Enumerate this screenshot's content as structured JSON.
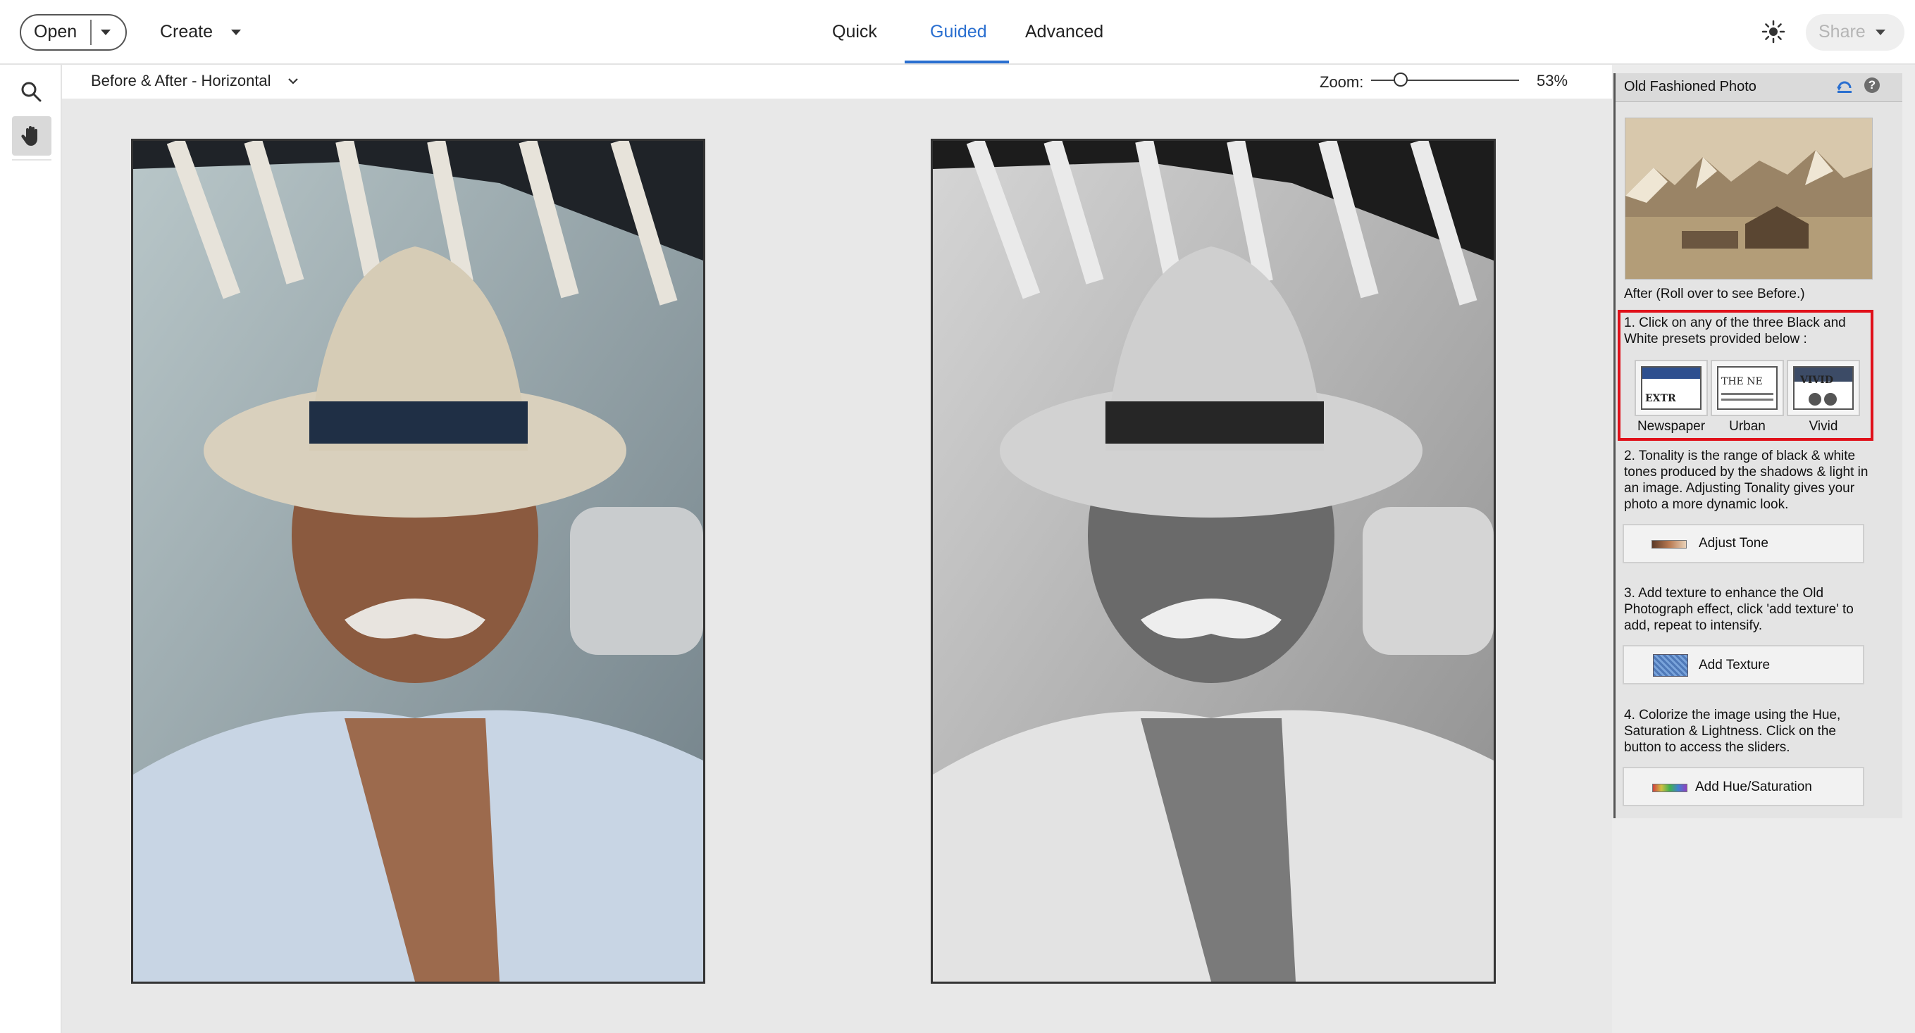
{
  "topbar": {
    "open_label": "Open",
    "create_label": "Create",
    "tabs": [
      {
        "label": "Quick"
      },
      {
        "label": "Guided"
      },
      {
        "label": "Advanced"
      }
    ],
    "active_tab": "Guided",
    "share_label": "Share"
  },
  "viewbar": {
    "view_mode": "Before & After - Horizontal",
    "zoom_label": "Zoom:",
    "zoom_value": "53%"
  },
  "panel": {
    "title": "Old Fashioned Photo",
    "help_glyph": "?",
    "preview_caption": "After (Roll over to see Before.)",
    "step1": "1. Click on any of the three Black and White presets provided below :",
    "presets": [
      {
        "label": "Newspaper",
        "thumb_text": "EXTR"
      },
      {
        "label": "Urban",
        "thumb_text": "THE NE"
      },
      {
        "label": "Vivid",
        "thumb_text": "VIVID"
      }
    ],
    "step2": "2. Tonality is the range of black & white tones produced by the shadows & light in an image. Adjusting Tonality gives your photo a more dynamic look.",
    "adjust_tone": "Adjust Tone",
    "step3": "3. Add texture to enhance the Old Photograph effect, click 'add texture' to add, repeat to intensify.",
    "add_texture": "Add Texture",
    "step4": "4. Colorize the image using the Hue, Saturation & Lightness. Click on the button to access the sliders.",
    "add_hue": "Add Hue/Saturation"
  },
  "colors": {
    "accent": "#2a6fd0",
    "highlight_box": "#e0101a",
    "canvas_bg": "#e8e8e8"
  }
}
